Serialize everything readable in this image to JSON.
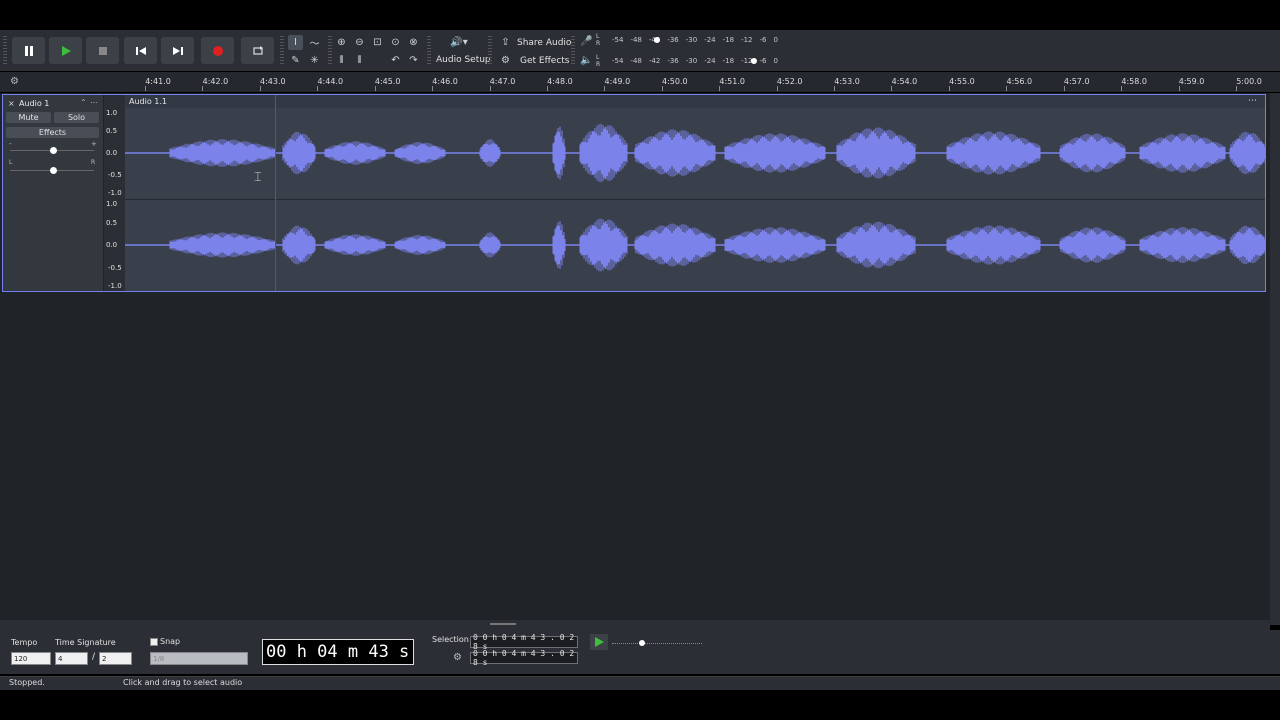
{
  "transport": {
    "buttons": [
      {
        "name": "pause-button",
        "icon": "pause-icon"
      },
      {
        "name": "play-button",
        "icon": "play-icon"
      },
      {
        "name": "stop-button",
        "icon": "stop-icon"
      },
      {
        "name": "skip-start-button",
        "icon": "skip-start-icon"
      },
      {
        "name": "skip-end-button",
        "icon": "skip-end-icon"
      },
      {
        "name": "record-button",
        "icon": "record-icon"
      },
      {
        "name": "loop-button",
        "icon": "loop-icon"
      }
    ]
  },
  "toolbar": {
    "audio_setup_label": "Audio Setup",
    "share_audio_label": "Share Audio",
    "get_effects_label": "Get Effects"
  },
  "meters": {
    "record_ticks": [
      "-54",
      "-48",
      "-42",
      "-36",
      "-30",
      "-24",
      "-18",
      "-12",
      "-6",
      "0"
    ],
    "playback_ticks": [
      "-54",
      "-48",
      "-42",
      "-36",
      "-30",
      "-24",
      "-18",
      "-12",
      "-6",
      "0"
    ],
    "record_channels": [
      "L",
      "R"
    ],
    "playback_channels": [
      "L",
      "R"
    ]
  },
  "ruler": {
    "ticks": [
      "4:41.0",
      "4:42.0",
      "4:43.0",
      "4:44.0",
      "4:45.0",
      "4:46.0",
      "4:47.0",
      "4:48.0",
      "4:49.0",
      "4:50.0",
      "4:51.0",
      "4:52.0",
      "4:53.0",
      "4:54.0",
      "4:55.0",
      "4:56.0",
      "4:57.0",
      "4:58.0",
      "4:59.0",
      "5:00.0"
    ]
  },
  "track": {
    "name": "Audio 1",
    "mute_label": "Mute",
    "solo_label": "Solo",
    "effects_label": "Effects",
    "gain_minus": "-",
    "gain_plus": "+",
    "pan_left": "L",
    "pan_right": "R",
    "clip_name": "Audio 1.1",
    "channel1_scale": [
      "1.0",
      "0.5",
      "0.0",
      "-0.5",
      "-1.0"
    ],
    "channel2_scale": [
      "1.0",
      "0.5",
      "0.0",
      "-0.5",
      "-1.0"
    ],
    "waveform_color": "#7b83eb"
  },
  "bottom": {
    "tempo_label": "Tempo",
    "tempo_value": "120",
    "time_signature_label": "Time Signature",
    "time_sig_upper": "4",
    "time_sig_separator": "/",
    "time_sig_lower": "2",
    "snap_label": "Snap",
    "snap_value": "1/8",
    "time_display": "00 h 04 m 43 s",
    "selection_label": "Selection",
    "selection_start": "0 0 h 0 4 m 4 3 . 0 2 8 s",
    "selection_end": "0 0 h 0 4 m 4 3 . 0 2 8 s"
  },
  "status": {
    "state": "Stopped.",
    "hint": "Click and drag to select audio"
  },
  "colors": {
    "accent": "#7380f0",
    "play_green": "#3dbf3d",
    "record_red": "#e02020"
  }
}
